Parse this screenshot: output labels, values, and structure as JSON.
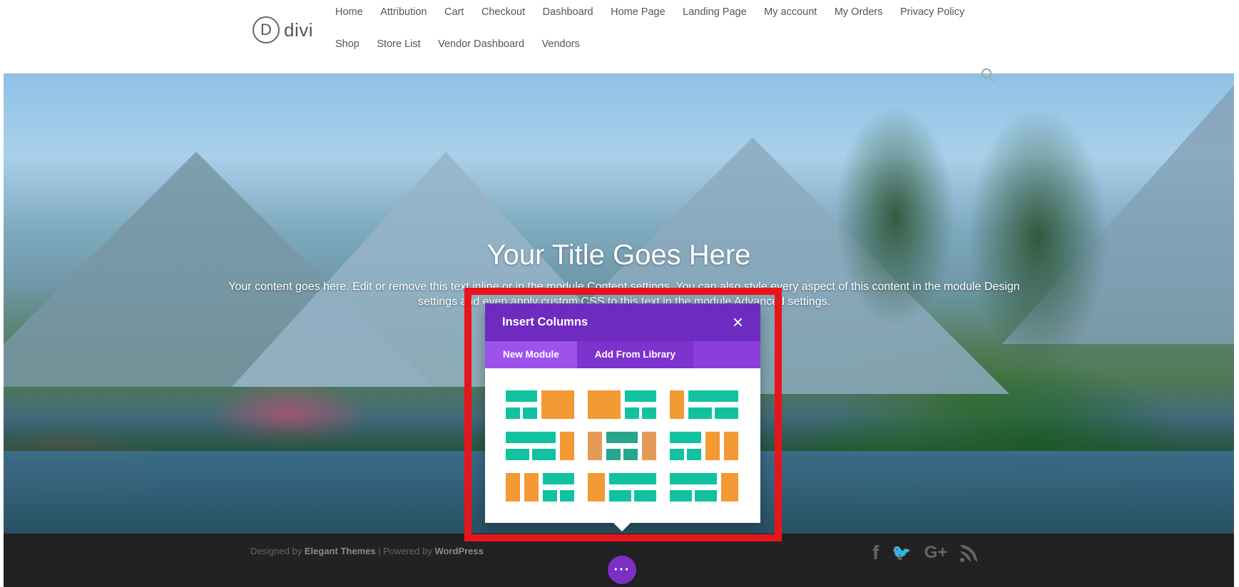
{
  "header": {
    "logo_letter": "D",
    "logo_text": "divi",
    "nav_row1": [
      "Home",
      "Attribution",
      "Cart",
      "Checkout",
      "Dashboard",
      "Home Page",
      "Landing Page",
      "My account",
      "My Orders",
      "Privacy Policy"
    ],
    "nav_row2": [
      "Shop",
      "Store List",
      "Vendor Dashboard",
      "Vendors"
    ]
  },
  "hero": {
    "title": "Your Title Goes Here",
    "body_line1": "Your content goes here. Edit or remove this text inline or in the module Content settings. You can also style every aspect of this content in the module Design",
    "body_line2": "settings and even apply custom CSS to this text in the module Advanced settings."
  },
  "modal": {
    "title": "Insert Columns",
    "close_glyph": "×",
    "tabs": [
      {
        "label": "New Module",
        "active": true
      },
      {
        "label": "Add From Library",
        "active": false
      }
    ],
    "options": [
      "2/3 with 1/2 + 1/2 sub-row, 1/3",
      "1/3, 2/3 with 1/2 + 1/2 sub-row",
      "1/4, 3/4 with 1/2 + 1/2 sub-row",
      "3/4 with 1/2 + 1/2 sub-row, 1/4",
      "1/4, 1/2 with 1/2 + 1/2 sub-row, 1/4",
      "1/2 with 1/2 + 1/2 sub-row, 1/4, 1/4",
      "1/4, 1/4, 1/2 with 1/2 + 1/2 sub-row",
      "1/3, 2/3 with 1/2 + 1/2 sub-row (variant)",
      "2/3 with 1/2 + 1/2 sub-row, 1/3 (variant)"
    ]
  },
  "footer": {
    "credit_prefix": "Designed by ",
    "credit_brand": "Elegant Themes",
    "credit_sep": " | Powered by ",
    "credit_wp": "WordPress",
    "social": {
      "facebook": "f",
      "twitter": "🐦",
      "google_plus": "G+"
    },
    "more_glyph": "···"
  },
  "colors": {
    "purple_header": "#6d2bbf",
    "purple_tabs": "#8b3edc",
    "teal": "#11c2a0",
    "orange": "#f39a34",
    "highlight_red": "#e8141c",
    "footer_bg": "#222222"
  }
}
